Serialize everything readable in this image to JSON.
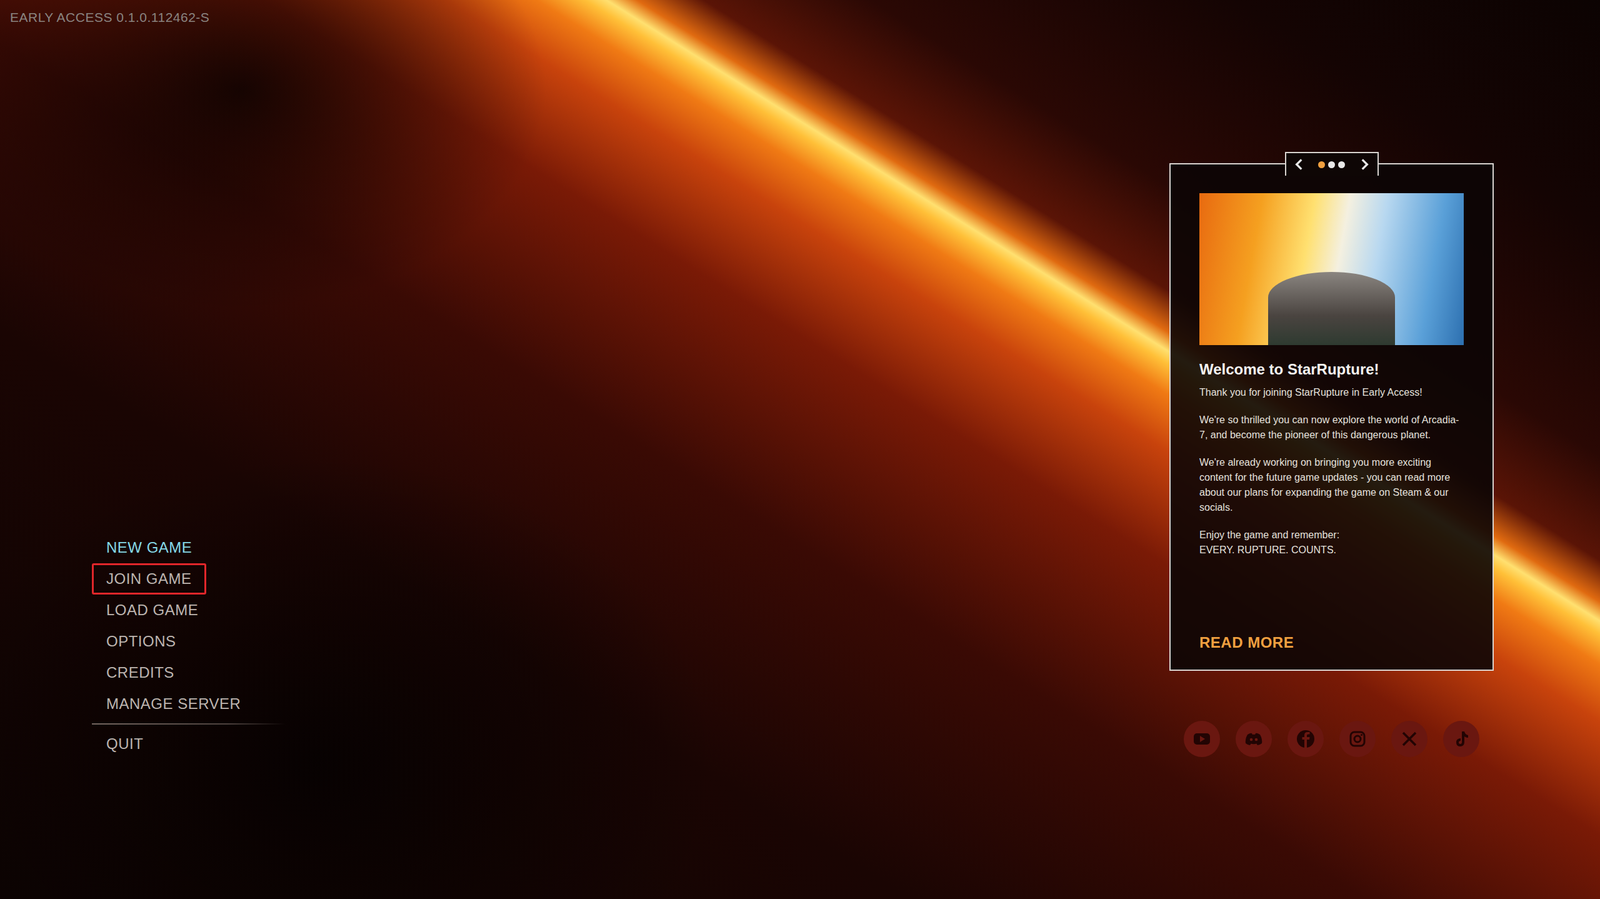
{
  "version": "EARLY ACCESS 0.1.0.112462-S",
  "menu": {
    "items": [
      {
        "label": "NEW GAME",
        "selected": true,
        "highlighted": false
      },
      {
        "label": "JOIN GAME",
        "selected": false,
        "highlighted": true
      },
      {
        "label": "LOAD GAME",
        "selected": false,
        "highlighted": false
      },
      {
        "label": "OPTIONS",
        "selected": false,
        "highlighted": false
      },
      {
        "label": "CREDITS",
        "selected": false,
        "highlighted": false
      },
      {
        "label": "MANAGE SERVER",
        "selected": false,
        "highlighted": false
      }
    ],
    "exit": {
      "label": "QUIT"
    }
  },
  "news": {
    "carousel": {
      "dots": [
        {
          "selected": true
        },
        {
          "selected": false
        },
        {
          "selected": false
        }
      ]
    },
    "title": "Welcome to StarRupture!",
    "paragraphs": [
      "Thank you for joining StarRupture in Early Access!",
      "We're so thrilled you can now explore the world of Arcadia-7, and become the pioneer of this dangerous planet.",
      "We're already working on bringing you more exciting content for the future game updates - you can read more about our plans for expanding the game on Steam & our socials.",
      "Enjoy the game and remember:\nEVERY. RUPTURE. COUNTS."
    ],
    "link": "READ MORE"
  }
}
